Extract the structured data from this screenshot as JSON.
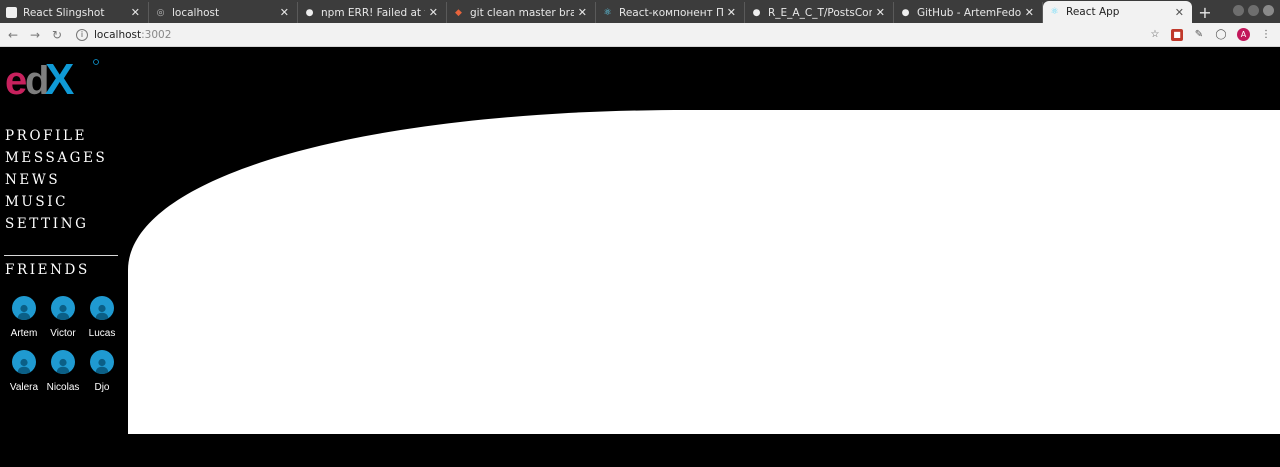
{
  "browser": {
    "tabs": [
      {
        "title": "React Slingshot",
        "icon": "square-page-icon",
        "active": false
      },
      {
        "title": "localhost",
        "icon": "globe-icon",
        "active": false
      },
      {
        "title": "npm ERR! Failed at the",
        "icon": "github-icon",
        "active": false
      },
      {
        "title": "git clean master branch",
        "icon": "git-icon",
        "active": false
      },
      {
        "title": "React-компонент Пане",
        "icon": "react-icon",
        "active": false
      },
      {
        "title": "R_E_A_C_T/PostsConta",
        "icon": "github-icon",
        "active": false
      },
      {
        "title": "GitHub - ArtemFedorch",
        "icon": "github-icon",
        "active": false
      },
      {
        "title": "React App",
        "icon": "react-icon",
        "active": true
      }
    ],
    "new_tab_label": "+",
    "url_host": "localhost",
    "url_port": ":3002",
    "profile_initial": "A"
  },
  "app": {
    "logo_text": "edX",
    "nav": [
      {
        "label": "PROFILE"
      },
      {
        "label": "MESSAGES"
      },
      {
        "label": "NEWS"
      },
      {
        "label": "MUSIC"
      },
      {
        "label": "SETTING"
      }
    ],
    "friends_title": "FRIENDS",
    "friends": [
      {
        "name": "Artem"
      },
      {
        "name": "Victor"
      },
      {
        "name": "Lucas"
      },
      {
        "name": "Valera"
      },
      {
        "name": "Nicolas"
      },
      {
        "name": "Djo"
      }
    ]
  },
  "colors": {
    "background": "#000000",
    "avatar": "#1f9ad1",
    "logo_magenta": "#c7215d",
    "logo_gray": "#8c8c8c",
    "logo_blue": "#0f9ad6"
  }
}
